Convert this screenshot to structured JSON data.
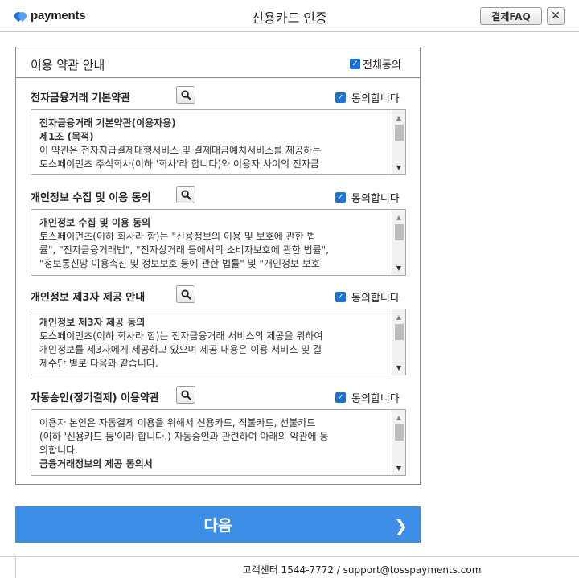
{
  "header": {
    "logo_text": "payments",
    "title": "신용카드 인증",
    "faq_label": "결제FAQ",
    "close_label": "✕"
  },
  "terms": {
    "title": "이용 약관 안내",
    "all_agree_label": "전체동의",
    "all_agree_checked": true,
    "sections": [
      {
        "title": "전자금융거래 기본약관",
        "agree_label": "동의합니다",
        "checked": true,
        "heading1": "전자금융거래 기본약관(이용자용)",
        "heading2": "제1조 (목적)",
        "body": "이 약관은 전자지급결제대행서비스 및 결제대금예치서비스를 제공하는\n토스페이먼츠 주식회사(이하 '회사'라 합니다)와 이용자 사이의 전자금"
      },
      {
        "title": "개인정보 수집 및 이용 동의",
        "agree_label": "동의합니다",
        "checked": true,
        "heading1": "개인정보 수집 및 이용 동의",
        "heading2": "",
        "body": "토스페이먼츠(이하 회사라 함)는 \"신용정보의 이용 및 보호에 관한 법\n률\", \"전자금융거래법\", \"전자상거래 등에서의 소비자보호에 관한 법률\",\n\"정보통신망 이용촉진 및 정보보호 등에 관한 법률\" 및 \"개인정보 보호"
      },
      {
        "title": "개인정보 제3자 제공 안내",
        "agree_label": "동의합니다",
        "checked": true,
        "heading1": "개인정보 제3자 제공 동의",
        "heading2": "",
        "body": "토스페이먼츠(이하 회사라 함)는 전자금융거래 서비스의 제공을 위하여\n개인정보를 제3자에게 제공하고 있으며 제공 내용은 이용 서비스 및 결\n제수단 별로 다음과 같습니다."
      },
      {
        "title": "자동승인(정기결제) 이용약관",
        "agree_label": "동의합니다",
        "checked": true,
        "heading1": "",
        "heading2": "",
        "body": "이용자 본인은 자동결제 이용을 위해서 신용카드, 직불카드, 선불카드\n(이하 '신용카드 등'이라 합니다.) 자동승인과 관련하여 아래의 약관에 동\n의합니다.",
        "tail": "금융거래정보의 제공 동의서"
      }
    ]
  },
  "next_button": {
    "label": "다음",
    "arrow": "❯"
  },
  "footer": {
    "text": "고객센터 1544-7772 / support@tosspayments.com"
  },
  "colors": {
    "accent": "#3d8ee6",
    "checkbox": "#1a73d6",
    "border": "#8a8a8a"
  }
}
